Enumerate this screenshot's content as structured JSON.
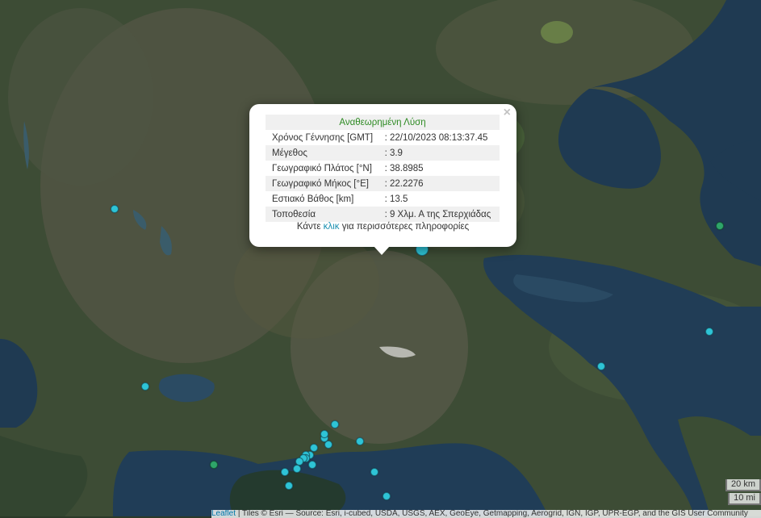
{
  "map": {
    "basemap": "satellite imagery",
    "marker_color": "#2ec4d6",
    "marker_alt_color": "#2fa56a",
    "markers": [
      {
        "lat": 39.02,
        "lon": 20.75,
        "mag": "small",
        "color": "cyan"
      },
      {
        "lat": 38.9,
        "lon": 22.23,
        "mag": "3.9",
        "color": "cyan",
        "selected": true
      },
      {
        "lat": 38.97,
        "lon": 23.66,
        "mag": "small",
        "color": "green"
      },
      {
        "lat": 38.66,
        "lon": 23.61,
        "mag": "small",
        "color": "cyan"
      },
      {
        "lat": 38.56,
        "lon": 23.09,
        "mag": "small",
        "color": "cyan"
      },
      {
        "lat": 38.39,
        "lon": 21.81,
        "mag": "small",
        "color": "cyan"
      },
      {
        "lat": 38.34,
        "lon": 21.93,
        "mag": "small",
        "color": "cyan"
      },
      {
        "lat": 38.33,
        "lon": 21.78,
        "mag": "small",
        "color": "cyan"
      },
      {
        "lat": 38.32,
        "lon": 21.71,
        "mag": "small",
        "color": "cyan"
      },
      {
        "lat": 38.3,
        "lon": 21.69,
        "mag": "small",
        "color": "cyan"
      },
      {
        "lat": 38.3,
        "lon": 21.67,
        "mag": "small",
        "color": "cyan"
      },
      {
        "lat": 38.29,
        "lon": 21.67,
        "mag": "small",
        "color": "cyan"
      },
      {
        "lat": 38.29,
        "lon": 21.66,
        "mag": "small",
        "color": "cyan"
      },
      {
        "lat": 38.28,
        "lon": 21.64,
        "mag": "small",
        "color": "cyan"
      },
      {
        "lat": 38.27,
        "lon": 21.7,
        "mag": "small",
        "color": "cyan"
      },
      {
        "lat": 38.26,
        "lon": 21.63,
        "mag": "small",
        "color": "cyan"
      },
      {
        "lat": 38.25,
        "lon": 21.57,
        "mag": "small",
        "color": "cyan"
      },
      {
        "lat": 38.21,
        "lon": 21.59,
        "mag": "small",
        "color": "cyan"
      },
      {
        "lat": 38.27,
        "lon": 21.23,
        "mag": "small",
        "color": "green"
      },
      {
        "lat": 38.25,
        "lon": 22.0,
        "mag": "small",
        "color": "cyan"
      },
      {
        "lat": 38.18,
        "lon": 22.06,
        "mag": "small",
        "color": "cyan"
      },
      {
        "lat": 38.35,
        "lon": 21.76,
        "mag": "small",
        "color": "cyan"
      },
      {
        "lat": 38.36,
        "lon": 21.76,
        "mag": "small",
        "color": "cyan"
      },
      {
        "lat": 38.5,
        "lon": 20.9,
        "mag": "small",
        "color": "cyan"
      }
    ]
  },
  "popup": {
    "title": "Αναθεωρημένη Λύση",
    "close": "×",
    "rows": [
      {
        "label": "Χρόνος Γέννησης [GMT]",
        "value": ": 22/10/2023 08:13:37.45"
      },
      {
        "label": "Μέγεθος",
        "value": ": 3.9"
      },
      {
        "label": "Γεωγραφικό Πλάτος [°N]",
        "value": ": 38.8985"
      },
      {
        "label": "Γεωγραφικό Μήκος [°E]",
        "value": ": 22.2276"
      },
      {
        "label": "Εστιακό Βάθος [km]",
        "value": ": 13.5"
      },
      {
        "label": "Τοποθεσία",
        "value": ": 9 Χλμ. Α της Σπερχιάδας"
      }
    ],
    "more_prefix": "Κάντε",
    "more_link": "κλικ",
    "more_suffix": "για περισσότερες πληροφορίες"
  },
  "scale": {
    "km": "20 km",
    "mi": "10 mi"
  },
  "attribution": {
    "leaflet": "Leaflet",
    "text": "| Tiles © Esri — Source: Esri, i-cubed, USDA, USGS, AEX, GeoEye, Getmapping, Aerogrid, IGN, IGP, UPR-EGP, and the GIS User Community"
  }
}
